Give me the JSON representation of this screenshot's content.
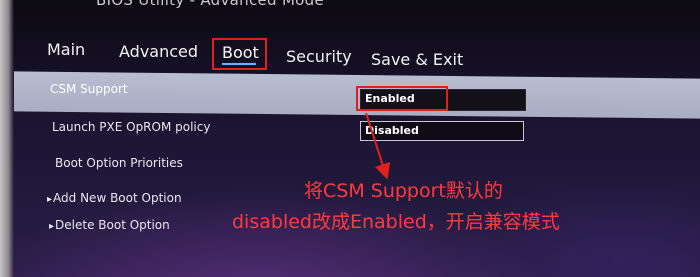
{
  "window": {
    "title": "BIOS Utility - Advanced Mode"
  },
  "tabs": [
    {
      "label": "Main",
      "active": false
    },
    {
      "label": "Advanced",
      "active": false
    },
    {
      "label": "Boot",
      "active": true
    },
    {
      "label": "Security",
      "active": false
    },
    {
      "label": "Save & Exit",
      "active": false
    }
  ],
  "settings": {
    "csm_support": {
      "label": "CSM Support",
      "value": "Enabled"
    },
    "launch_pxe": {
      "label": "Launch PXE OpROM policy",
      "value": "Disabled"
    },
    "boot_option_priorities": {
      "label": "Boot Option Priorities"
    },
    "add_new_boot_option": {
      "label": "Add New Boot Option",
      "chevron": "▸"
    },
    "delete_boot_option": {
      "label": "Delete Boot Option",
      "chevron": "▸"
    }
  },
  "annotation": {
    "line1": "将CSM Support默认的",
    "line2": "disabled改成Enabled，开启兼容模式"
  },
  "colors": {
    "highlight_row": "#b9bdd0",
    "annotation_red": "#ff3b3b",
    "box_red": "#e0201c",
    "active_underline": "#5fb3ff"
  },
  "icons": {
    "annotation_arrow": "arrow-icon"
  }
}
